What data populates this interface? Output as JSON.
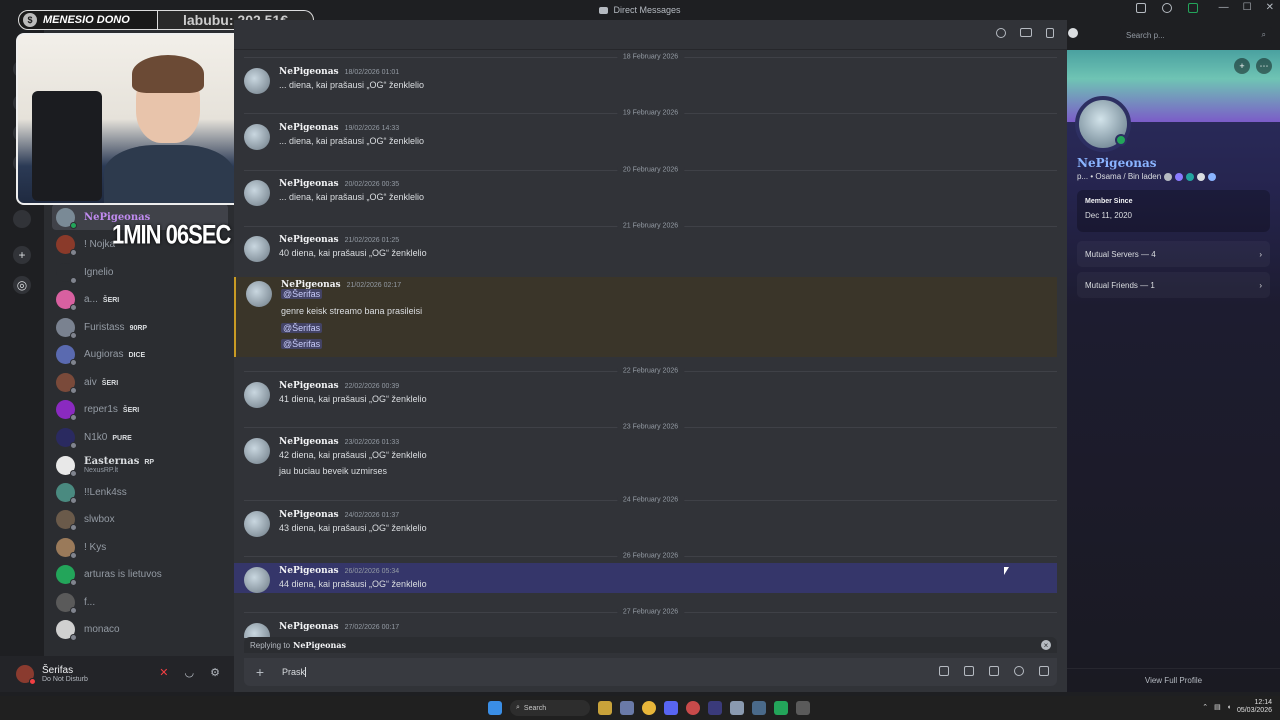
{
  "window": {
    "title": "Direct Messages"
  },
  "overlay": {
    "donate_name": "MENESIO DONO",
    "donate_amount": "labubu: 202.51€",
    "timer": "1MIN 06SEC"
  },
  "sidebar": {
    "items": [
      {
        "name": "NePigeonas",
        "tag": "",
        "fancy": true,
        "status": "online",
        "color": "#7a8a96"
      },
      {
        "name": "! Nojka",
        "tag": "",
        "status": "offline",
        "color": "#8a3a2a"
      },
      {
        "name": "Ignelio",
        "tag": "",
        "status": "offline",
        "color": "#2b2d31"
      },
      {
        "name": "a...",
        "tag": "ŠERI",
        "status": "offline",
        "color": "#d860a0"
      },
      {
        "name": "Furistass",
        "tag": "90RP",
        "status": "offline",
        "color": "#7a8290"
      },
      {
        "name": "Augioras",
        "tag": "DICE",
        "status": "offline",
        "color": "#5a6ab0"
      },
      {
        "name": "aiv",
        "tag": "ŠERI",
        "status": "offline",
        "color": "#7a4a3a"
      },
      {
        "name": "reper1s",
        "tag": "ŠERI",
        "status": "offline",
        "color": "#8a2ac0"
      },
      {
        "name": "N1k0",
        "tag": "PURE",
        "status": "offline",
        "color": "#2a2a60"
      },
      {
        "name": "Easternas",
        "tag": "RP",
        "sub": "NexusRP.lt",
        "fancy": true,
        "status": "offline",
        "color": "#e8e8e8"
      },
      {
        "name": "!!Lenk4ss",
        "tag": "",
        "status": "offline",
        "color": "#4a8a80"
      },
      {
        "name": "slwbox",
        "tag": "",
        "status": "offline",
        "color": "#6a5a4a"
      },
      {
        "name": "! Kys",
        "tag": "",
        "status": "offline",
        "color": "#9a7a5a"
      },
      {
        "name": "arturas is lietuvos",
        "tag": "",
        "status": "offline",
        "color": "#23a55a"
      },
      {
        "name": "f...",
        "tag": "",
        "status": "offline",
        "color": "#5a5a5a"
      },
      {
        "name": "monaco",
        "tag": "",
        "status": "offline",
        "color": "#d0d0d0"
      }
    ]
  },
  "user": {
    "name": "Šerifas",
    "status": "Do Not Disturb"
  },
  "header": {
    "search_placeholder": "Search p..."
  },
  "messages": {
    "author": "NePigeonas",
    "items": [
      {
        "divider": "18 February 2026",
        "time": "18/02/2026 01:01",
        "lines": [
          "... diena, kai prašausi „OG“ ženklelio"
        ]
      },
      {
        "divider": "19 February 2026",
        "time": "19/02/2026 14:33",
        "lines": [
          "... diena, kai prašausi „OG“ ženklelio"
        ]
      },
      {
        "divider": "20 February 2026",
        "time": "20/02/2026 00:35",
        "lines": [
          "... diena, kai prašausi „OG“ ženklelio"
        ]
      },
      {
        "divider": "21 February 2026",
        "time": "21/02/2026 01:25",
        "lines": [
          "40 diena, kai prašausi „OG“ ženklelio"
        ]
      },
      {
        "divider": "",
        "time": "21/02/2026 02:17",
        "lines": [
          "@Šerifas",
          "genre keisk streamo bana prasileisi",
          "@Šerifas",
          "@Šerifas"
        ]
      },
      {
        "divider": "22 February 2026",
        "time": "22/02/2026 00:39",
        "lines": [
          "41 diena, kai prašausi „OG“ ženklelio"
        ]
      },
      {
        "divider": "23 February 2026",
        "time": "23/02/2026 01:33",
        "lines": [
          "42 diena, kai prašausi „OG“ ženklelio",
          "jau buciau beveik uzmirses"
        ]
      },
      {
        "divider": "24 February 2026",
        "time": "24/02/2026 01:37",
        "lines": [
          "43 diena, kai prašausi „OG“ ženklelio"
        ]
      },
      {
        "divider": "26 February 2026",
        "time": "26/02/2026 05:34",
        "lines": [
          "44 diena, kai prašausi „OG“ ženklelio"
        ]
      },
      {
        "divider": "27 February 2026",
        "time": "27/02/2026 00:17",
        "lines": []
      }
    ]
  },
  "composer": {
    "reply_prefix": "Replying to",
    "reply_to": "NePigeonas",
    "text": "Prask"
  },
  "profile": {
    "name": "NePigeonas",
    "subtitle": "p... • Osama / Bin laden",
    "member_since_label": "Member Since",
    "member_since": "Dec 11, 2020",
    "mutual_servers": "Mutual Servers — 4",
    "mutual_friends": "Mutual Friends — 1",
    "view_full": "View Full Profile"
  },
  "taskbar": {
    "search": "Search",
    "time": "12:14",
    "date": "05/03/2026"
  },
  "colors": {
    "accent": "#5865f2",
    "highlight": "#c99b24",
    "online": "#23a55a",
    "dnd": "#f23f43"
  }
}
